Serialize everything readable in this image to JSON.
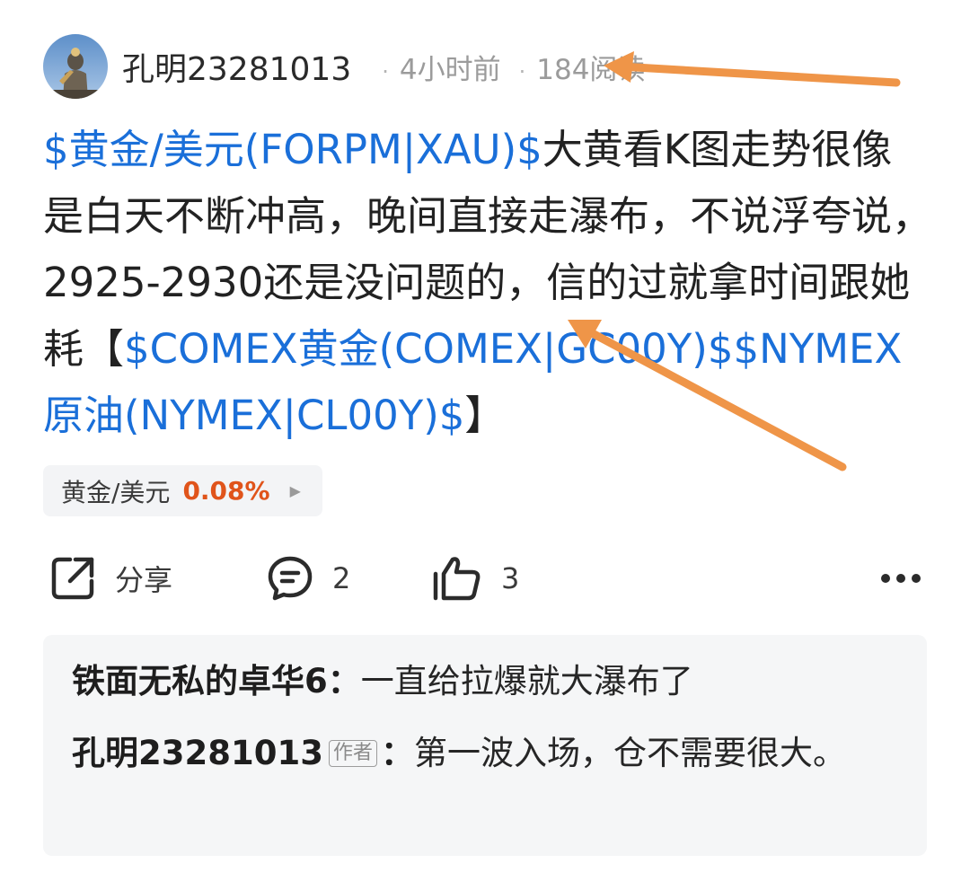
{
  "header": {
    "author": "孔明23281013",
    "time_ago": "4小时前",
    "reads": "184阅读"
  },
  "post": {
    "parts": [
      {
        "text": "$黄金/美元(FORPM|XAU)$",
        "type": "stock-link"
      },
      {
        "text": "大黄看K图走势很像是白天不断冲高，晚间直接走瀑布，不说浮夸说，2925-2930还是没问题的，信的过就拿时间跟她耗【",
        "type": "text"
      },
      {
        "text": "$COMEX黄金(COMEX|GC00Y)$",
        "type": "stock-link"
      },
      {
        "text": "$NYMEX原油(NYMEX|CL00Y)$",
        "type": "stock-link"
      },
      {
        "text": "】",
        "type": "text"
      }
    ]
  },
  "stock_chip": {
    "name": "黄金/美元",
    "change": "0.08%",
    "arrow_icon": "play-triangle-icon",
    "change_color": "#e0541b"
  },
  "actions": {
    "share_label": "分享",
    "comment_count": "2",
    "like_count": "3",
    "share_icon": "share-icon",
    "comment_icon": "comment-bubble-icon",
    "like_icon": "thumbs-up-icon",
    "more_icon": "more-horizontal-icon"
  },
  "comments": [
    {
      "author": "铁面无私的卓华6",
      "tag": "",
      "separator": "：",
      "text": "一直给拉爆就大瀑布了"
    },
    {
      "author": "孔明23281013",
      "tag": "作者",
      "separator": "：",
      "text": "第一波入场，仓不需要很大。"
    }
  ],
  "colors": {
    "link": "#1a6fd9",
    "annotation_arrow": "#ef9548",
    "comment_bg": "#f5f6f7"
  }
}
